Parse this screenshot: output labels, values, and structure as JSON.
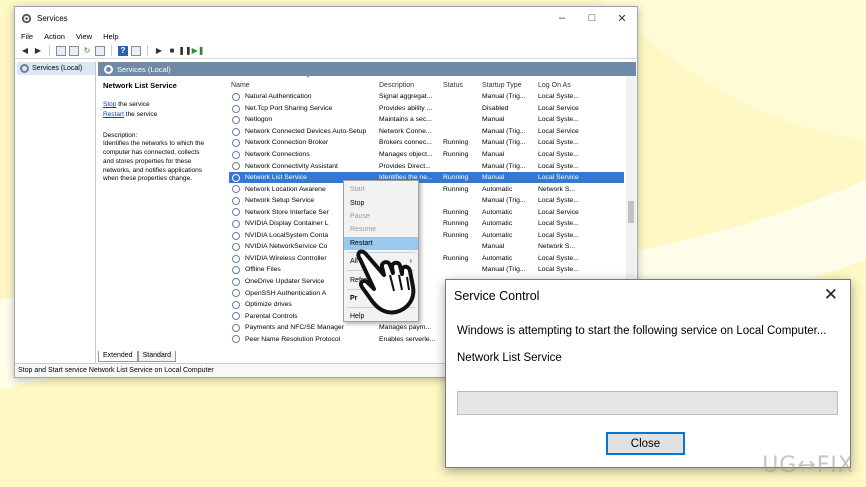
{
  "window": {
    "title": "Services",
    "icon": "services-gear-icon",
    "minimize_icon": "minimize-icon",
    "maximize_icon": "maximize-icon",
    "close_icon": "close-icon"
  },
  "menu": [
    "File",
    "Action",
    "View",
    "Help"
  ],
  "toolbar_icons": [
    "back-arrow-icon",
    "forward-arrow-icon",
    "console-tree-icon",
    "properties-icon",
    "refresh-icon",
    "export-list-icon",
    "help-icon",
    "view-icon",
    "start-service-icon",
    "stop-service-icon",
    "pause-service-icon",
    "restart-service-icon"
  ],
  "tree": {
    "label": "Services (Local)"
  },
  "pane_header": "Services (Local)",
  "details": {
    "title": "Network List Service",
    "stop_link": "Stop",
    "stop_suffix": "the service",
    "restart_link": "Restart",
    "restart_suffix": "the service",
    "description_label": "Description:",
    "description_lines": [
      "Identifies the networks to which the",
      "computer has connected, collects",
      "and stores properties for these",
      "networks, and notifies applications",
      "when these properties change."
    ]
  },
  "columns": [
    "Name",
    "Description",
    "Status",
    "Startup Type",
    "Log On As"
  ],
  "services": [
    {
      "name": "Natural Authentication",
      "description": "Signal aggregat...",
      "status": "",
      "startup": "Manual (Trig...",
      "logon": "Local Syste..."
    },
    {
      "name": "Net.Tcp Port Sharing Service",
      "description": "Provides ability ...",
      "status": "",
      "startup": "Disabled",
      "logon": "Local Service"
    },
    {
      "name": "Netlogon",
      "description": "Maintains a sec...",
      "status": "",
      "startup": "Manual",
      "logon": "Local Syste..."
    },
    {
      "name": "Network Connected Devices Auto-Setup",
      "description": "Network Conne...",
      "status": "",
      "startup": "Manual (Trig...",
      "logon": "Local Service"
    },
    {
      "name": "Network Connection Broker",
      "description": "Brokers connec...",
      "status": "Running",
      "startup": "Manual (Trig...",
      "logon": "Local Syste..."
    },
    {
      "name": "Network Connections",
      "description": "Manages object...",
      "status": "Running",
      "startup": "Manual",
      "logon": "Local Syste..."
    },
    {
      "name": "Network Connectivity Assistant",
      "description": "Provides Direct...",
      "status": "",
      "startup": "Manual (Trig...",
      "logon": "Local Syste..."
    },
    {
      "name": "Network List Service",
      "description": "Identifies the ne...",
      "status": "Running",
      "startup": "Manual",
      "logon": "Local Service",
      "selected": true
    },
    {
      "name": "Network Location Awarene",
      "description": "nd sto...",
      "status": "Running",
      "startup": "Automatic",
      "logon": "Network S..."
    },
    {
      "name": "Network Setup Service",
      "description": "twork Se...",
      "status": "",
      "startup": "Manual (Trig...",
      "logon": "Local Syste..."
    },
    {
      "name": "Network Store Interface Ser",
      "description": "ce deli...",
      "status": "Running",
      "startup": "Automatic",
      "logon": "Local Service"
    },
    {
      "name": "NVIDIA Display Container L",
      "description": "r servi...",
      "status": "Running",
      "startup": "Automatic",
      "logon": "Local Syste..."
    },
    {
      "name": "NVIDIA LocalSystem Conta",
      "description": "r servi...",
      "status": "Running",
      "startup": "Automatic",
      "logon": "Local Syste..."
    },
    {
      "name": "NVIDIA NetworkService Co",
      "description": "r servi...",
      "status": "",
      "startup": "Manual",
      "logon": "Network S..."
    },
    {
      "name": "NVIDIA Wireless Controller",
      "description": "Wireles...",
      "status": "Running",
      "startup": "Automatic",
      "logon": "Local Syste..."
    },
    {
      "name": "Offline Files",
      "description": "ne File...",
      "status": "",
      "startup": "Manual (Trig...",
      "logon": "Local Syste..."
    },
    {
      "name": "OneDrive Updater Service",
      "description": "ur One...",
      "status": "",
      "startup": "",
      "logon": ""
    },
    {
      "name": "OpenSSH Authentication A",
      "description": "o hold p",
      "status": "",
      "startup": "",
      "logon": ""
    },
    {
      "name": "Optimize drives",
      "description": "e comp",
      "status": "",
      "startup": "",
      "logon": ""
    },
    {
      "name": "Parental Controls",
      "description": "parent...",
      "status": "",
      "startup": "",
      "logon": ""
    },
    {
      "name": "Payments and NFC/SE Manager",
      "description": "Manages paym...",
      "status": "",
      "startup": "",
      "logon": ""
    },
    {
      "name": "Peer Name Resolution Protocol",
      "description": "Enables serverle...",
      "status": "",
      "startup": "",
      "logon": ""
    }
  ],
  "context_menu": [
    {
      "label": "Start",
      "disabled": true
    },
    {
      "label": "Stop",
      "disabled": false
    },
    {
      "label": "Pause",
      "disabled": true
    },
    {
      "label": "Resume",
      "disabled": true
    },
    {
      "label": "Restart",
      "disabled": false,
      "highlighted": true
    },
    {
      "separator": true
    },
    {
      "label": "All",
      "disabled": false,
      "submenu": true
    },
    {
      "separator": true
    },
    {
      "label": "Refre",
      "disabled": false
    },
    {
      "separator": true
    },
    {
      "label": "Pr",
      "disabled": false,
      "bold": true
    },
    {
      "separator": true
    },
    {
      "label": "Help",
      "disabled": false
    }
  ],
  "tabs": [
    "Extended",
    "Standard"
  ],
  "status_bar": "Stop and Start service Network List Service on Local Computer",
  "dialog": {
    "title": "Service Control",
    "message": "Windows is attempting to start the following service on Local Computer...",
    "service_name": "Network List Service",
    "progress": 0,
    "button": "Close",
    "close_icon": "close-icon"
  },
  "cursor_icon": "hand-pointer-icon",
  "watermark": "UG↔FIX",
  "colors": {
    "background": "#fdf8c4",
    "selection": "#3478d4",
    "pane_header": "#6f8aa6",
    "menu_highlight": "#99c9ef",
    "button_border": "#0078d7",
    "link": "#0645ad"
  }
}
